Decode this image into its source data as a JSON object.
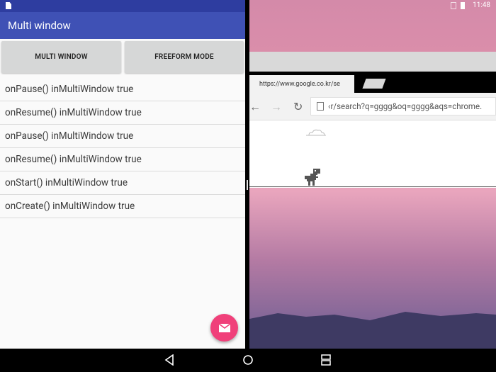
{
  "left_app": {
    "title": "Multi window",
    "buttons": {
      "multi_window": "MULTI WINDOW",
      "freeform_mode": "FREEFORM MODE"
    },
    "log_entries": [
      "onPause() inMultiWindow true",
      "onResume() inMultiWindow true",
      "onPause() inMultiWindow true",
      "onResume() inMultiWindow true",
      "onStart() inMultiWindow true",
      "onCreate() inMultiWindow true"
    ],
    "fab_icon": "mail-icon",
    "colors": {
      "appbar": "#3f51b5",
      "status": "#2e3da0",
      "fab": "#f0407a"
    }
  },
  "right_app": {
    "status_time": "11:48",
    "tab_title": "https://www.google.co.kr/se",
    "url": "‹r/search?q=gggg&oq=gggg&aqs=chrome."
  },
  "navbar": {
    "icons": [
      "back-icon",
      "home-icon",
      "recents-icon"
    ]
  }
}
